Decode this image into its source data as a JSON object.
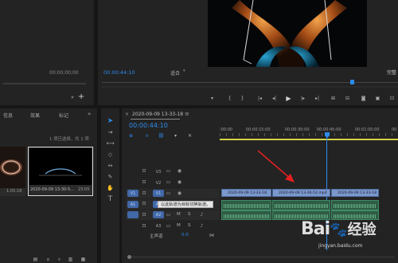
{
  "program_monitor": {
    "timecode": "00:00:44:10",
    "fit_label": "适合",
    "right_label": "完整"
  },
  "source_monitor": {
    "timecode": "00:00;00;00"
  },
  "project_panel": {
    "tabs": [
      "信息",
      "效果",
      "标记"
    ],
    "selection_status": "1 项已选择，共 1 项",
    "items": [
      {
        "duration": "1:05:18"
      },
      {
        "name": "2020-09-09 13-30-5...",
        "duration": "23:05"
      }
    ]
  },
  "timeline": {
    "sequence_tab": "2020-09-09 13-33-18",
    "timecode": "00:00:44:10",
    "ruler_labels": [
      ":00:00",
      "00:00:15:00",
      "00:00:30:00",
      "00:00:45:00",
      "00:01:00:00",
      "00"
    ],
    "tracks": {
      "video": [
        {
          "label": "V3"
        },
        {
          "label": "V2"
        },
        {
          "label": "V1",
          "src": "V1"
        }
      ],
      "audio": [
        {
          "label": "A1",
          "src": "A1",
          "m": "M",
          "s": "S"
        },
        {
          "label": "A2",
          "m": "M",
          "s": "S"
        },
        {
          "label": "A3",
          "m": "M",
          "s": "S"
        }
      ],
      "master_label": "主声道",
      "master_value": "0.0"
    },
    "video_clips": [
      "2020-09-09 13-33-18",
      "2020-09-09 13-30-52.mp4",
      "2020-09-09 13-33-18"
    ],
    "tooltip": "以此轨道为目标切换轨道。"
  },
  "watermark": {
    "text": "Bai",
    "text2": "经验",
    "url": "jingyan.baidu.com"
  },
  "colors": {
    "accent": "#2d8ceb",
    "video_clip": "#7b98cc",
    "audio_clip": "#2f5b45",
    "annotation_arrow": "#e02020"
  }
}
